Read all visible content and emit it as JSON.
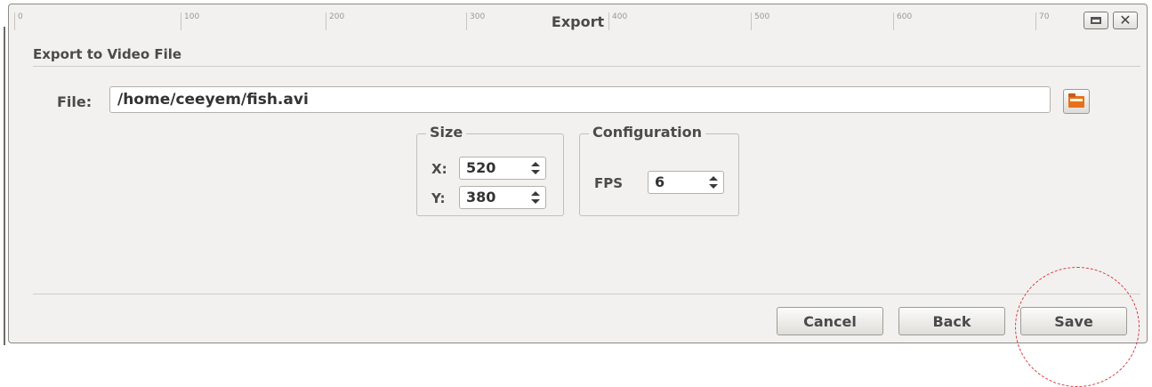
{
  "window": {
    "title": "Export",
    "ruler_ticks": [
      "0",
      "100",
      "200",
      "300",
      "400",
      "500",
      "600",
      "70"
    ]
  },
  "header": {
    "section_title": "Export to Video File"
  },
  "file": {
    "label": "File:",
    "value": "/home/ceeyem/fish.avi",
    "browse_icon": "folder-open-icon"
  },
  "size_group": {
    "title": "Size",
    "x_label": "X:",
    "x_value": "520",
    "y_label": "Y:",
    "y_value": "380"
  },
  "config_group": {
    "title": "Configuration",
    "fps_label": "FPS",
    "fps_value": "6"
  },
  "buttons": {
    "cancel": "Cancel",
    "back": "Back",
    "save": "Save"
  },
  "colors": {
    "accent_folder": "#e8701c",
    "highlight": "#d83a3a",
    "dialog_bg": "#f2f1f0"
  }
}
